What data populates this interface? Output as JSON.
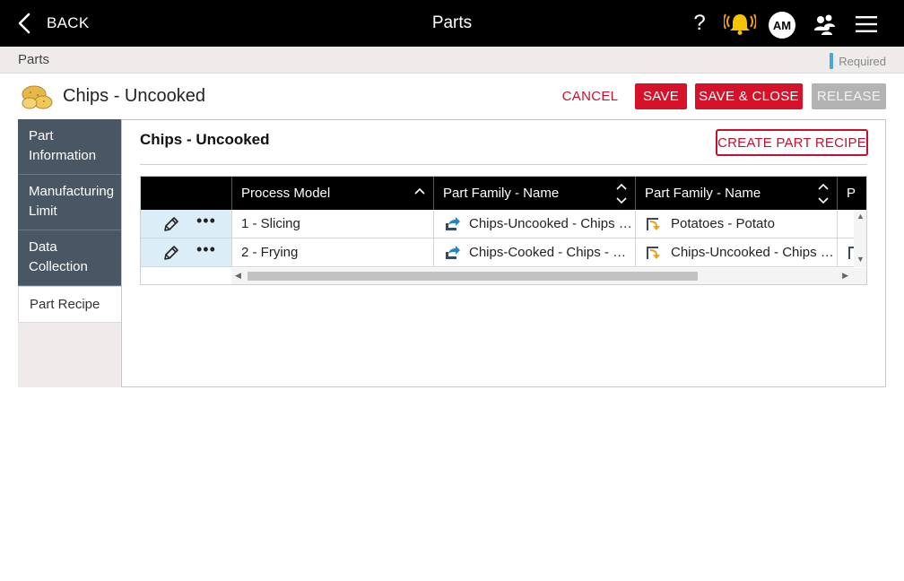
{
  "topbar": {
    "back_label": "BACK",
    "title": "Parts",
    "help": "?",
    "avatar_initials": "AM"
  },
  "breadcrumb": {
    "current": "Parts",
    "required_label": "Required"
  },
  "header": {
    "part_title": "Chips - Uncooked",
    "cancel": "CANCEL",
    "save": "SAVE",
    "save_close": "SAVE & CLOSE",
    "release": "RELEASE"
  },
  "sidenav": {
    "items": [
      {
        "label_line1": "Part",
        "label_line2": "Information"
      },
      {
        "label_line1": "Manufacturing",
        "label_line2": "Limit"
      },
      {
        "label_line1": "Data",
        "label_line2": "Collection"
      },
      {
        "label_line1": "Part Recipe"
      }
    ]
  },
  "panel": {
    "title": "Chips - Uncooked",
    "create_button": "CREATE PART RECIPE"
  },
  "grid": {
    "columns": [
      "Process Model",
      "Part Family - Name",
      "Part Family - Name",
      "P"
    ],
    "rows": [
      {
        "process_model": "1 - Slicing",
        "output": "Chips-Uncooked - Chips - ...",
        "input": "Potatoes - Potato"
      },
      {
        "process_model": "2 - Frying",
        "output": "Chips-Cooked - Chips - Co...",
        "input": "Chips-Uncooked - Chips - ..."
      }
    ]
  },
  "colors": {
    "accent_red": "#d6122a",
    "nav_bg": "#495663",
    "required_blue": "#4aa6d9",
    "bell_yellow": "#f5c400"
  },
  "icons": [
    "chevron-left-icon",
    "help-icon",
    "bell-icon",
    "user-group-icon",
    "hamburger-menu-icon",
    "potato-icon",
    "pencil-icon",
    "more-dots-icon",
    "output-arrow-icon",
    "input-arrow-icon",
    "sort-icon"
  ]
}
